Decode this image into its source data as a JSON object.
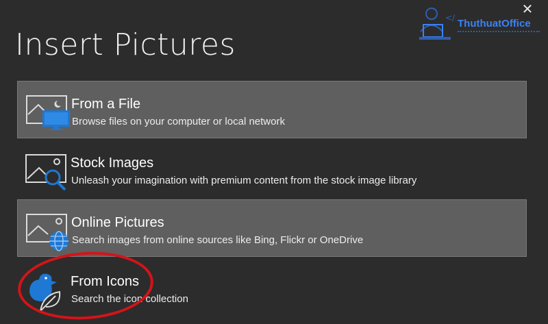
{
  "dialog": {
    "title": "Insert Pictures",
    "close_glyph": "✕"
  },
  "watermark": {
    "brand": "ThuthuatOffice"
  },
  "options": [
    {
      "title": "From a File",
      "description": "Browse files on your computer or local network",
      "icon": "picture-monitor-icon",
      "highlighted": true
    },
    {
      "title": "Stock Images",
      "description": "Unleash your imagination with premium content from the stock image library",
      "icon": "picture-search-icon",
      "highlighted": false
    },
    {
      "title": "Online Pictures",
      "description": "Search images from online sources like Bing, Flickr or OneDrive",
      "icon": "picture-globe-icon",
      "highlighted": true
    },
    {
      "title": "From Icons",
      "description": "Search the icon collection",
      "icon": "bird-leaf-icon",
      "highlighted": false
    }
  ],
  "colors": {
    "background": "#2c2c2c",
    "highlight": "#5f5f5f",
    "accent_blue": "#1e78d4",
    "annotation_red": "#d3141a"
  }
}
